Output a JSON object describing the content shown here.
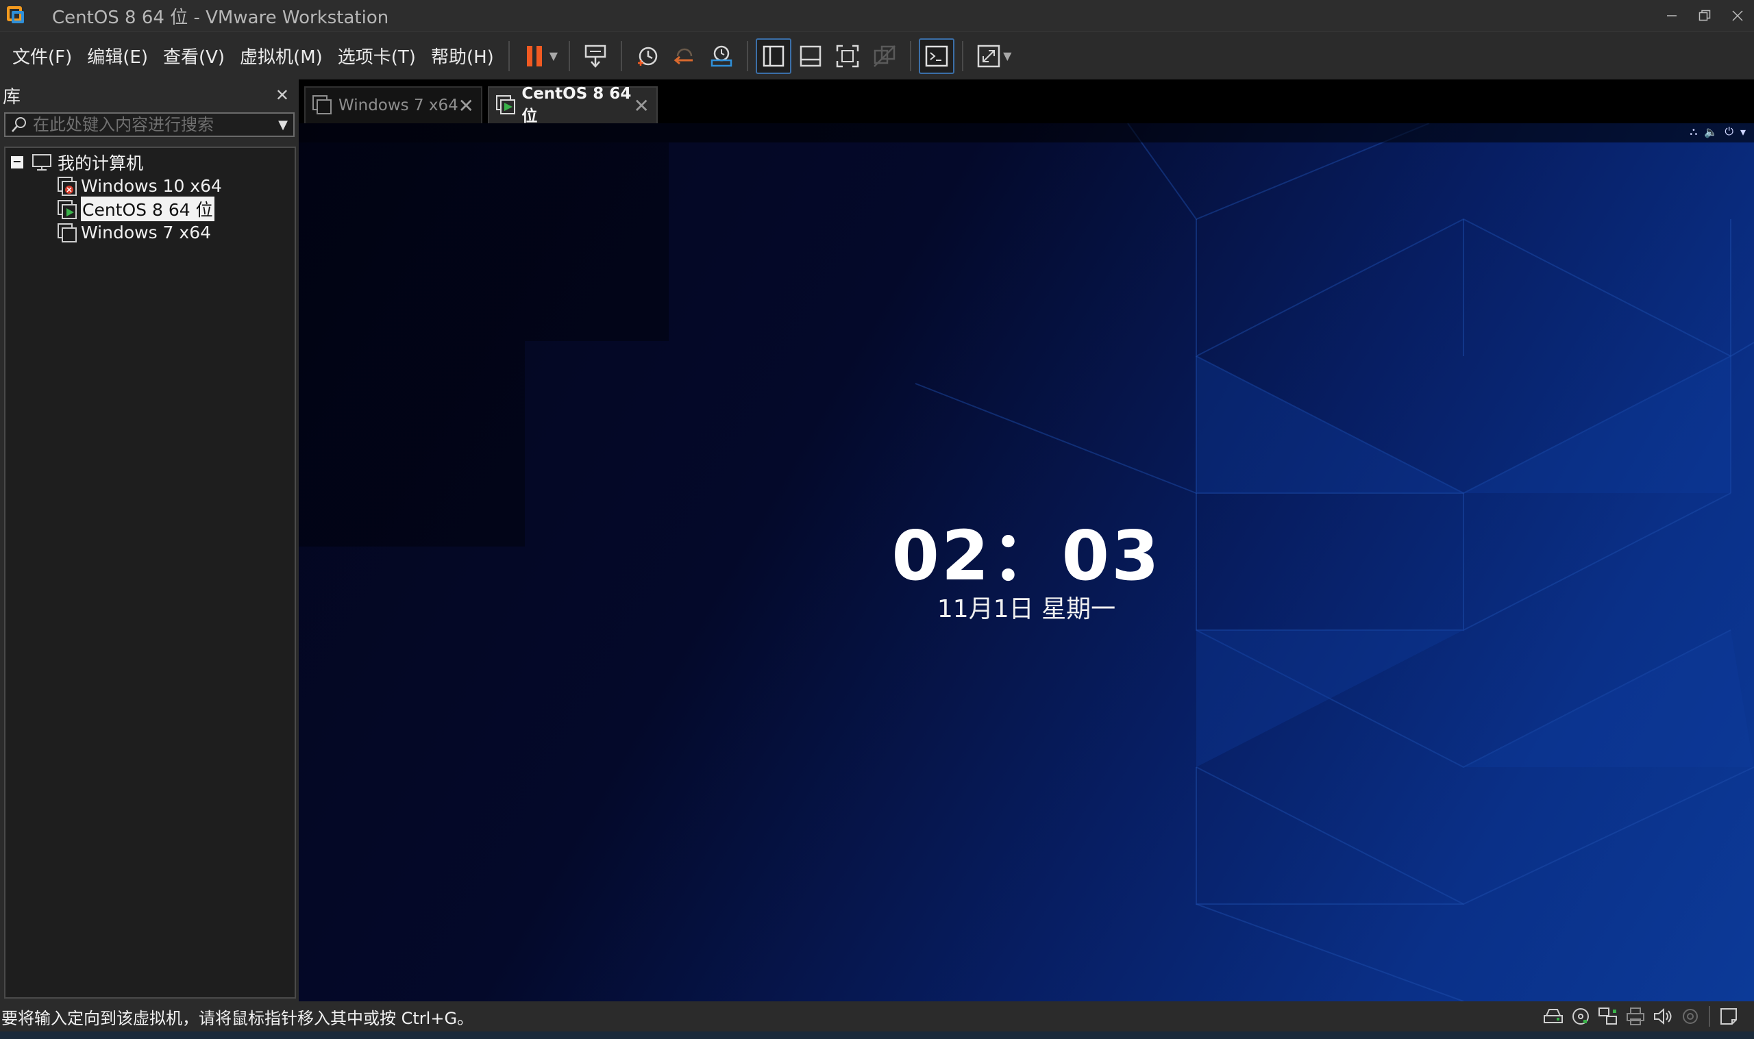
{
  "window": {
    "title": "CentOS 8 64 位 - VMware Workstation",
    "controls": [
      "minimize-icon",
      "restore-icon",
      "close-icon"
    ]
  },
  "menu": {
    "items": [
      "文件(F)",
      "编辑(E)",
      "查看(V)",
      "虚拟机(M)",
      "选项卡(T)",
      "帮助(H)"
    ]
  },
  "toolbar": {
    "icons": [
      "pause-icon",
      "send-ctrl-alt-del-icon",
      "snapshot-icon",
      "revert-snapshot-icon",
      "snapshot-manager-icon",
      "library-view-icon",
      "thumbnail-bar-icon",
      "fullscreen-icon",
      "unity-icon",
      "console-icon",
      "stretch-icon"
    ],
    "pause_color": "#f15a22"
  },
  "library": {
    "title": "库",
    "search_placeholder": "在此处键入内容进行搜索",
    "tree": {
      "root": "我的计算机",
      "vms": [
        {
          "name": "Windows 10 x64",
          "state": "error"
        },
        {
          "name": "CentOS 8 64 位",
          "state": "running",
          "selected": true
        },
        {
          "name": "Windows 7 x64",
          "state": "off"
        }
      ]
    }
  },
  "tabs": [
    {
      "label": "Windows 7 x64",
      "active": false
    },
    {
      "label": "CentOS 8 64 位",
      "active": true
    }
  ],
  "vm_screen": {
    "time": "02：03",
    "date": "11月1日 星期一",
    "status_icons": [
      "network-icon",
      "volume-icon",
      "power-icon",
      "chevron-down-icon"
    ]
  },
  "statusbar": {
    "message": "要将输入定向到该虚拟机，请将鼠标指针移入其中或按 Ctrl+G。",
    "devices": [
      "hard-disk-icon",
      "cd-dvd-icon",
      "network-adapter-icon",
      "printer-icon",
      "sound-icon",
      "usb-icon",
      "message-icon"
    ]
  },
  "colors": {
    "accent_blue": "#2f8fd8",
    "vm_running_green": "#3ab34a",
    "vm_error_red": "#d23b2a"
  }
}
